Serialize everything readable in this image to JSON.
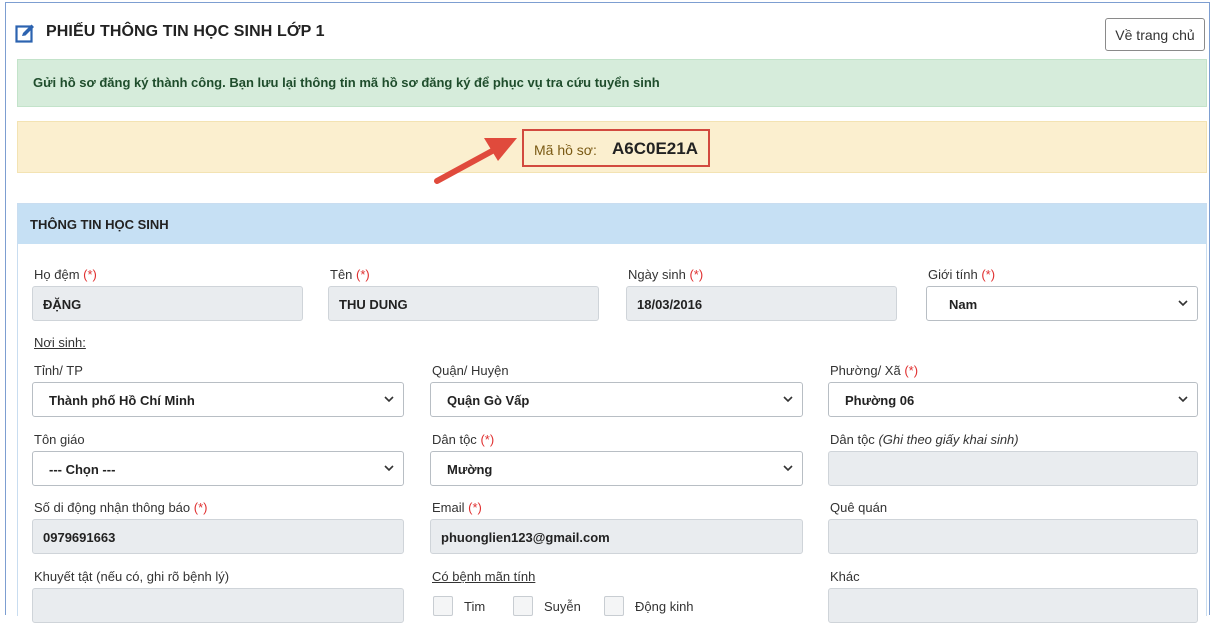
{
  "header": {
    "title": "PHIẾU THÔNG TIN HỌC SINH LỚP 1",
    "home_button": "Về trang chủ"
  },
  "alerts": {
    "success_message": "Gửi hồ sơ đăng ký thành công. Bạn lưu lại thông tin mã hồ sơ đăng ký để phục vụ tra cứu tuyển sinh",
    "code_label": "Mã hồ sơ:",
    "code_value": "A6C0E21A"
  },
  "section": {
    "title": "THÔNG TIN HỌC SINH"
  },
  "required_mark": "(*)",
  "fields": {
    "ho_dem": {
      "label": "Họ đệm",
      "value": "ĐẶNG"
    },
    "ten": {
      "label": "Tên",
      "value": "THU DUNG"
    },
    "ngay_sinh": {
      "label": "Ngày sinh",
      "value": "18/03/2016"
    },
    "gioi_tinh": {
      "label": "Giới tính",
      "value": "Nam"
    },
    "noi_sinh": {
      "label": "Nơi sinh:"
    },
    "tinh": {
      "label": "Tỉnh/ TP",
      "value": "Thành phố Hồ Chí Minh"
    },
    "quan": {
      "label": "Quận/ Huyện",
      "value": "Quận Gò Vấp"
    },
    "phuong": {
      "label": "Phường/ Xã",
      "value": "Phường 06"
    },
    "ton_giao": {
      "label": "Tôn giáo",
      "value": "--- Chọn ---"
    },
    "dan_toc": {
      "label": "Dân tộc",
      "value": "Mường"
    },
    "dan_toc_ks": {
      "label": "Dân tộc",
      "note": "(Ghi theo giấy khai sinh)",
      "value": ""
    },
    "so_di_dong": {
      "label": "Số di động nhận thông báo",
      "value": "0979691663"
    },
    "email": {
      "label": "Email",
      "value": "phuonglien123@gmail.com"
    },
    "que_quan": {
      "label": "Quê quán",
      "value": ""
    },
    "khuyet_tat": {
      "label": "Khuyết tật (nếu có, ghi rõ bệnh lý)",
      "value": ""
    },
    "benh_man_tinh": {
      "label": "Có bệnh mãn tính",
      "options": [
        "Tim",
        "Suyễn",
        "Động kinh"
      ]
    },
    "khac": {
      "label": "Khác",
      "value": ""
    }
  },
  "colors": {
    "required": "#e03030",
    "success_bg": "#d6ecdb",
    "warning_bg": "#fbefcf",
    "section_bg": "#c6e0f4",
    "highlight": "#d24a3f"
  },
  "icons": {
    "title": "edit-square-icon",
    "arrow": "arrow-pointer-icon",
    "select": "chevron-down-icon"
  }
}
